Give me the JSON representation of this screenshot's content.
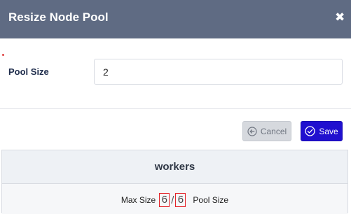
{
  "dialog": {
    "title": "Resize Node Pool",
    "close_glyph": "✖"
  },
  "form": {
    "pool_size_label": "Pool Size",
    "pool_size_value": "2"
  },
  "actions": {
    "cancel_label": "Cancel",
    "save_label": "Save"
  },
  "pool": {
    "name": "workers",
    "max_size_label": "Max Size",
    "max_size_value": "6",
    "separator": "/",
    "pool_size_value": "6",
    "pool_size_label": "Pool Size"
  },
  "icons": {
    "close": "close-icon",
    "cancel": "arrow-left-circle-icon",
    "save": "check-circle-icon"
  },
  "colors": {
    "header_bg": "#5f6b83",
    "save_bg": "#2010cf",
    "cancel_bg": "#d6d9de",
    "highlight_border": "#e4242a"
  }
}
